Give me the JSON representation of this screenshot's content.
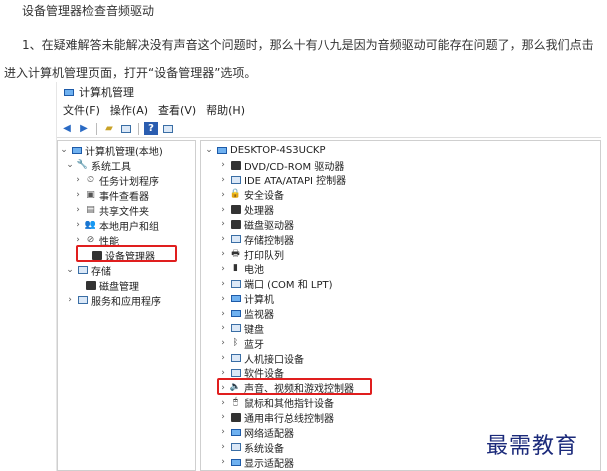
{
  "article": {
    "heading": "设备管理器检查音频驱动",
    "para1": "1、在疑难解答未能解决没有声音这个问题时，那么十有八九是因为音频驱动可能存在问题了，那么我们点击",
    "para2": "进入计算机管理页面，打开“设备管理器”选项。"
  },
  "window": {
    "title": "计算机管理",
    "menu": [
      "文件(F)",
      "操作(A)",
      "查看(V)",
      "帮助(H)"
    ]
  },
  "left_tree": [
    {
      "label": "计算机管理(本地)",
      "icon": "computer-management-icon",
      "expander": "v"
    },
    {
      "label": "系统工具",
      "icon": "tools-icon",
      "expander": "v"
    },
    {
      "label": "任务计划程序",
      "icon": "task-scheduler-icon",
      "expander": ">"
    },
    {
      "label": "事件查看器",
      "icon": "event-viewer-icon",
      "expander": ">"
    },
    {
      "label": "共享文件夹",
      "icon": "shared-folder-icon",
      "expander": ">"
    },
    {
      "label": "本地用户和组",
      "icon": "users-icon",
      "expander": ">"
    },
    {
      "label": "性能",
      "icon": "performance-icon",
      "expander": ">"
    },
    {
      "label": "设备管理器",
      "icon": "device-manager-icon",
      "expander": ""
    },
    {
      "label": "存储",
      "icon": "storage-icon",
      "expander": "v"
    },
    {
      "label": "磁盘管理",
      "icon": "disk-management-icon",
      "expander": ""
    },
    {
      "label": "服务和应用程序",
      "icon": "services-icon",
      "expander": ">"
    }
  ],
  "device_tree": {
    "root": "DESKTOP-4S3UCKP",
    "items": [
      {
        "label": "DVD/CD-ROM 驱动器",
        "icon": "dvd-drive-icon"
      },
      {
        "label": "IDE ATA/ATAPI 控制器",
        "icon": "ide-controller-icon"
      },
      {
        "label": "安全设备",
        "icon": "security-device-icon"
      },
      {
        "label": "处理器",
        "icon": "processor-icon"
      },
      {
        "label": "磁盘驱动器",
        "icon": "disk-drive-icon"
      },
      {
        "label": "存储控制器",
        "icon": "storage-controller-icon"
      },
      {
        "label": "打印队列",
        "icon": "printer-icon"
      },
      {
        "label": "电池",
        "icon": "battery-icon"
      },
      {
        "label": "端口 (COM 和 LPT)",
        "icon": "port-icon"
      },
      {
        "label": "计算机",
        "icon": "computer-icon"
      },
      {
        "label": "监视器",
        "icon": "monitor-icon"
      },
      {
        "label": "键盘",
        "icon": "keyboard-icon"
      },
      {
        "label": "蓝牙",
        "icon": "bluetooth-icon"
      },
      {
        "label": "人机接口设备",
        "icon": "hid-icon"
      },
      {
        "label": "软件设备",
        "icon": "software-device-icon"
      },
      {
        "label": "声音、视频和游戏控制器",
        "icon": "sound-icon"
      },
      {
        "label": "鼠标和其他指针设备",
        "icon": "mouse-icon"
      },
      {
        "label": "通用串行总线控制器",
        "icon": "usb-icon"
      },
      {
        "label": "网络适配器",
        "icon": "network-adapter-icon"
      },
      {
        "label": "系统设备",
        "icon": "system-device-icon"
      },
      {
        "label": "显示适配器",
        "icon": "display-adapter-icon"
      }
    ]
  },
  "highlight_color": "#e01e1e",
  "watermark": "最需教育"
}
